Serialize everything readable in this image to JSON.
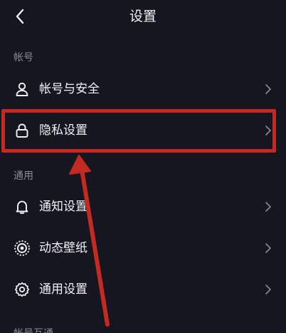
{
  "header": {
    "title": "设置"
  },
  "sections": {
    "account": {
      "label": "帐号"
    },
    "general": {
      "label": "通用"
    },
    "cut": {
      "label": "帐号互通"
    }
  },
  "rows": {
    "account_security": {
      "label": "帐号与安全",
      "icon": "person-icon"
    },
    "privacy": {
      "label": "隐私设置",
      "icon": "lock-icon"
    },
    "notifications": {
      "label": "通知设置",
      "icon": "bell-icon"
    },
    "live_wallpaper": {
      "label": "动态壁纸",
      "icon": "wallpaper-icon"
    },
    "general_settings": {
      "label": "通用设置",
      "icon": "gear-icon"
    }
  },
  "colors": {
    "background": "#15161f",
    "highlight": "#c42922",
    "text": "#f2f2f4",
    "muted": "#8a8b93"
  }
}
